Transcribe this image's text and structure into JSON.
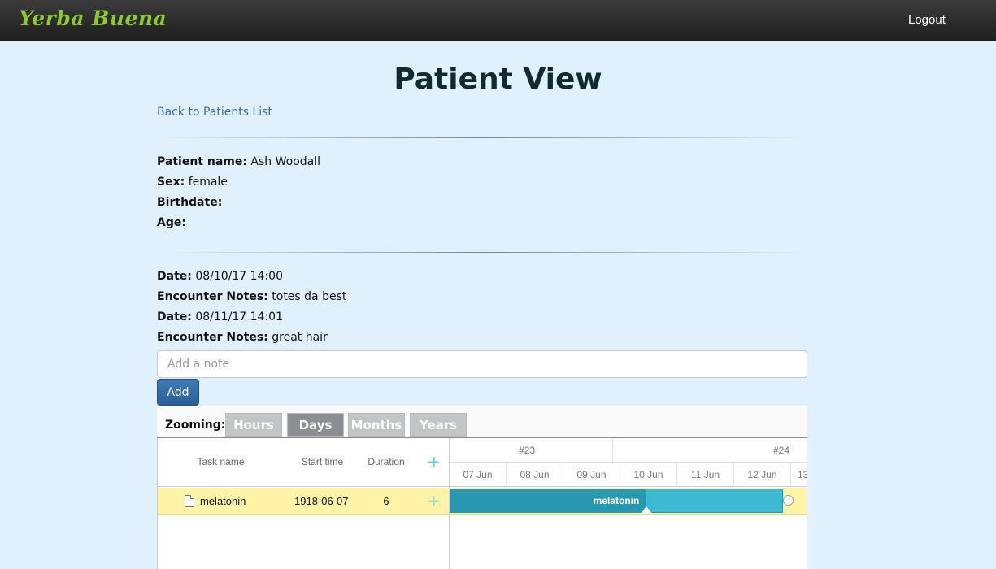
{
  "navbar": {
    "brand": "Yerba Buena",
    "logout": "Logout"
  },
  "page": {
    "title": "Patient View",
    "back_link": "Back to Patients List"
  },
  "patient": {
    "name_label": "Patient name:",
    "name": "Ash Woodall",
    "sex_label": "Sex:",
    "sex": "female",
    "birthdate_label": "Birthdate:",
    "birthdate": "",
    "age_label": "Age:",
    "age": ""
  },
  "encounters": [
    {
      "date_label": "Date:",
      "date": "08/10/17 14:00",
      "notes_label": "Encounter Notes:",
      "notes": "totes da best"
    },
    {
      "date_label": "Date:",
      "date": "08/11/17 14:01",
      "notes_label": "Encounter Notes:",
      "notes": "great hair"
    }
  ],
  "note_form": {
    "placeholder": "Add a note",
    "add_label": "Add"
  },
  "gantt": {
    "zoom_label": "Zooming:",
    "zoom_options": [
      "Hours",
      "Days",
      "Months",
      "Years"
    ],
    "zoom_selected": "Days",
    "columns": {
      "task_name": "Task name",
      "start_time": "Start time",
      "duration": "Duration",
      "add": "+"
    },
    "tasks": [
      {
        "name": "melatonin",
        "start": "1918-06-07",
        "duration": "6",
        "add": "+",
        "progress": 0.59
      }
    ],
    "weeks": [
      "#23",
      "#24"
    ],
    "days": [
      "07 Jun",
      "08 Jun",
      "09 Jun",
      "10 Jun",
      "11 Jun",
      "12 Jun",
      "13"
    ],
    "accent": "#3db9d3",
    "progress_color": "#2898b0",
    "row_highlight": "#fff3a8"
  }
}
